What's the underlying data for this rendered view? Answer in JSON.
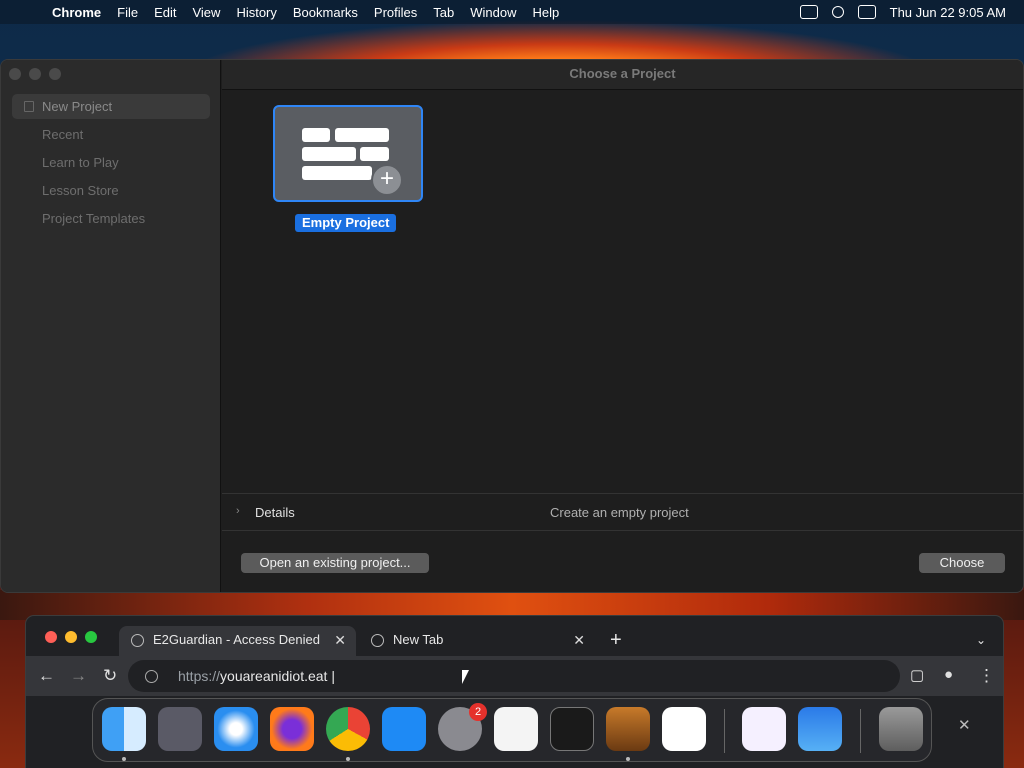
{
  "menubar": {
    "apple": "",
    "app_name": "Chrome",
    "items": [
      "File",
      "Edit",
      "View",
      "History",
      "Bookmarks",
      "Profiles",
      "Tab",
      "Window",
      "Help"
    ],
    "datetime": "Thu Jun 22  9:05 AM"
  },
  "chooser": {
    "title": "Choose a Project",
    "sidebar": [
      "New Project",
      "Recent",
      "Learn to Play",
      "Lesson Store",
      "Project Templates"
    ],
    "selected_sidebar": "New Project",
    "template_label": "Empty Project",
    "details_label": "Details",
    "details_desc": "Create an empty project",
    "open_existing": "Open an existing project...",
    "choose": "Choose"
  },
  "chrome": {
    "tabs": [
      {
        "title": "E2Guardian - Access Denied",
        "active": true
      },
      {
        "title": "New Tab",
        "active": false
      }
    ],
    "new_tab": "+",
    "close_glyph": "✕",
    "url_scheme": "https://",
    "url_host": "youareanidiot.eat"
  },
  "dock": {
    "apps": [
      "Finder",
      "Launchpad",
      "Safari",
      "Firefox",
      "Chrome",
      "App Store",
      "System Settings",
      "TextEdit",
      "Terminal",
      "GarageBand",
      "Visual Studio Code",
      "Visual Studio",
      "Weather",
      "Trash"
    ],
    "settings_badge": "2"
  }
}
